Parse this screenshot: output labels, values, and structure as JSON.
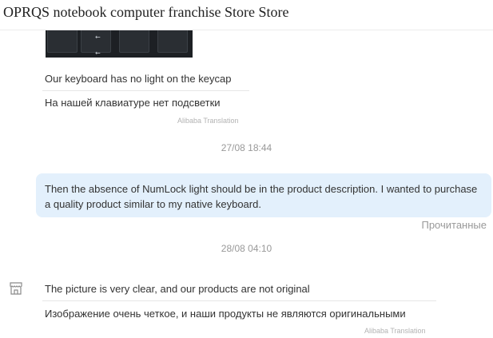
{
  "header": {
    "title": "OPRQS notebook computer franchise Store Store"
  },
  "image": {
    "icon": "keyboard-photo",
    "arrow_glyph": "←"
  },
  "messages": [
    {
      "sender": "seller",
      "original": "Our keyboard has no light on the keycap",
      "translation": "На нашей клавиатуре нет подсветки",
      "credit": "Alibaba Translation"
    },
    {
      "sender": "buyer",
      "timestamp": "27/08 18:44",
      "text": "Then the absence of NumLock light should be in the product description. I wanted to purchase a quality product similar to my native keyboard.",
      "status": "Прочитанные"
    },
    {
      "sender": "seller",
      "timestamp": "28/08 04:10",
      "original": "The picture is very clear, and our products are not original",
      "translation": "Изображение очень четкое, и наши продукты не являются оригинальными",
      "credit": "Alibaba Translation",
      "avatar_icon": "store-icon"
    }
  ],
  "colors": {
    "bubble_bg": "#e3f0fc",
    "muted_text": "#999999",
    "credit_text": "#b3b3b3"
  }
}
